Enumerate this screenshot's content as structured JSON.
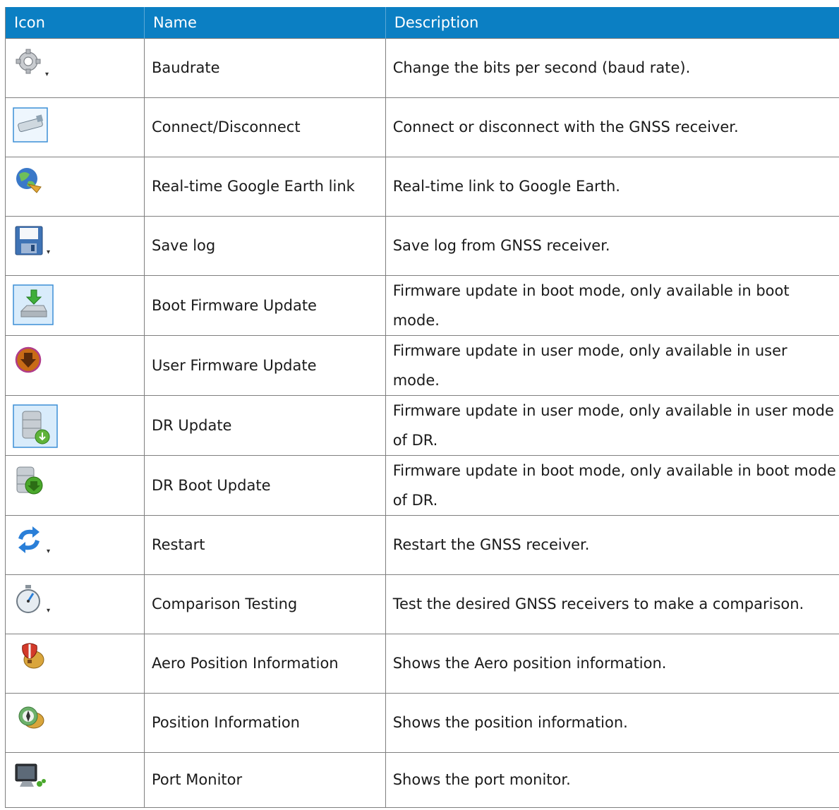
{
  "header": {
    "icon": "Icon",
    "name": "Name",
    "description": "Description"
  },
  "rows": [
    {
      "icon": "gear-icon",
      "name": "Baudrate",
      "description": "Change the bits per second (baud rate)."
    },
    {
      "icon": "usb-stick-icon",
      "name": "Connect/Disconnect",
      "description": "Connect or disconnect with the GNSS receiver."
    },
    {
      "icon": "globe-icon",
      "name": "Real-time Google Earth link",
      "description": "Real-time link to Google Earth."
    },
    {
      "icon": "floppy-disk-icon",
      "name": "Save log",
      "description": "Save log from GNSS receiver."
    },
    {
      "icon": "drive-download-icon",
      "name": "Boot Firmware Update",
      "description": "Firmware update in boot mode, only available in boot mode."
    },
    {
      "icon": "download-circle-icon",
      "name": "User Firmware Update",
      "description": "Firmware update in user mode, only available in user mode."
    },
    {
      "icon": "database-download-icon",
      "name": "DR Update",
      "description": "Firmware update in user mode, only available in user mode of DR."
    },
    {
      "icon": "database-green-download-icon",
      "name": "DR Boot Update",
      "description": "Firmware update in boot mode, only available in boot mode of DR."
    },
    {
      "icon": "refresh-arrows-icon",
      "name": "Restart",
      "description": "Restart the GNSS receiver."
    },
    {
      "icon": "stopwatch-icon",
      "name": "Comparison Testing",
      "description": "Test the desired GNSS receivers to make a comparison."
    },
    {
      "icon": "hot-air-balloon-icon",
      "name": "Aero Position Information",
      "description": "Shows the Aero position information."
    },
    {
      "icon": "compass-icon",
      "name": "Position Information",
      "description": "Shows the position information."
    },
    {
      "icon": "monitor-icon",
      "name": "Port Monitor",
      "description": "Shows the port monitor."
    }
  ]
}
